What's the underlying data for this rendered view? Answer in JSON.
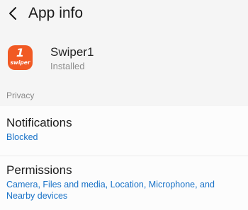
{
  "header": {
    "title": "App info",
    "back_icon": "chevron-left-icon"
  },
  "app": {
    "icon_number": "1",
    "icon_text": "swiper",
    "icon_color": "#f15a24",
    "name": "Swiper1",
    "status": "Installed"
  },
  "privacy": {
    "section_label": "Privacy",
    "notifications": {
      "title": "Notifications",
      "value": "Blocked"
    },
    "permissions": {
      "title": "Permissions",
      "value": "Camera, Files and media, Location, Microphone, and Nearby devices"
    }
  },
  "colors": {
    "link_blue": "#1a73c8",
    "background": "#f5f5f5"
  }
}
